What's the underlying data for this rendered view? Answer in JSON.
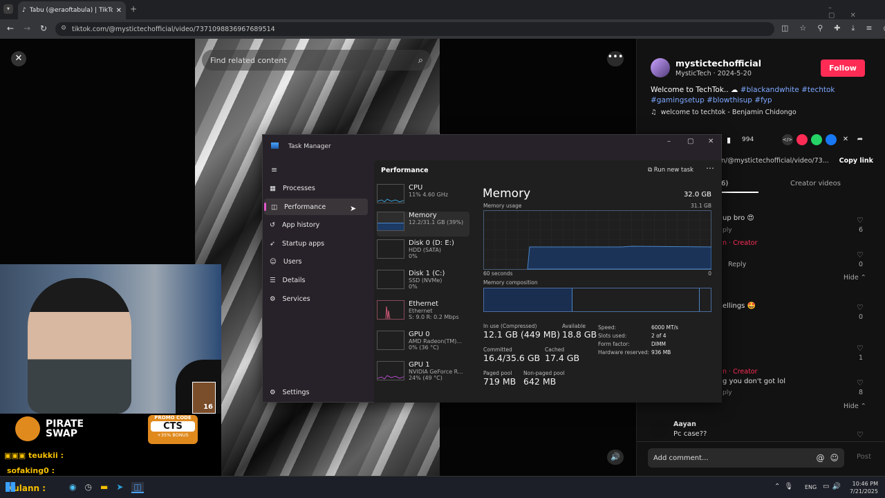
{
  "browser": {
    "tab_title": "Tabu (@eraoftabula) | TikTok",
    "url": "tiktok.com/@mystictechofficial/video/7371098836967689514"
  },
  "video": {
    "search_placeholder": "Find related content"
  },
  "post": {
    "username": "mystictechofficial",
    "meta": "MysticTech · 2024-5-20",
    "follow_label": "Follow",
    "caption_text": "Welcome to TechTok..",
    "hashtags": [
      "#blackandwhite",
      "#techtok",
      "#gamingsetup",
      "#blowthisup",
      "#fyp"
    ],
    "music": "welcome to techtok - Benjamin Chidongo",
    "bookmark_count": "994",
    "link_partial": "n/@mystictechofficial/video/73...",
    "copy_link_label": "Copy link",
    "tab_comments_partial": "6)",
    "tab_creator_videos": "Creator videos"
  },
  "comments": {
    "items": [
      {
        "text": "up bro 😍",
        "likes": "6"
      },
      {
        "text": "n · Creator",
        "likes": "0",
        "reply": "Reply"
      },
      {
        "text": "ellings 🤩",
        "likes": "0"
      },
      {
        "text": "",
        "likes": "1"
      },
      {
        "text": "n · Creator",
        "sub": "g you don't got lol",
        "likes": "8"
      },
      {
        "user": "Aayan",
        "text": "Pc case??"
      }
    ],
    "hide_label": "Hide",
    "reply_fragment": "ply",
    "add_comment_placeholder": "Add comment...",
    "post_label": "Post"
  },
  "task_manager": {
    "title": "Task Manager",
    "nav": [
      "Processes",
      "Performance",
      "App history",
      "Startup apps",
      "Users",
      "Details",
      "Services"
    ],
    "settings_label": "Settings",
    "section_title": "Performance",
    "run_new_task": "Run new task",
    "resources": [
      {
        "name": "CPU",
        "sub": "11% 4.60 GHz",
        "sub2": ""
      },
      {
        "name": "Memory",
        "sub": "12.2/31.1 GB (39%)",
        "sub2": ""
      },
      {
        "name": "Disk 0 (D: E:)",
        "sub": "HDD (SATA)",
        "sub2": "0%"
      },
      {
        "name": "Disk 1 (C:)",
        "sub": "SSD (NVMe)",
        "sub2": "0%"
      },
      {
        "name": "Ethernet",
        "sub": "Ethernet",
        "sub2": "S: 9.0 R: 0.2 Mbps"
      },
      {
        "name": "GPU 0",
        "sub": "AMD Radeon(TM)...",
        "sub2": "0% (36 °C)"
      },
      {
        "name": "GPU 1",
        "sub": "NVIDIA GeForce R...",
        "sub2": "24% (49 °C)"
      }
    ],
    "memory": {
      "heading": "Memory",
      "total": "32.0 GB",
      "usage_label": "Memory usage",
      "usage_max": "31.1 GB",
      "time_left": "60 seconds",
      "time_right": "0",
      "composition_label": "Memory composition",
      "in_use_fraction": 0.39,
      "stats": {
        "in_use_label": "In use (Compressed)",
        "in_use": "12.1 GB (449 MB)",
        "available_label": "Available",
        "available": "18.8 GB",
        "committed_label": "Committed",
        "committed": "16.4/35.6 GB",
        "cached_label": "Cached",
        "cached": "17.4 GB",
        "paged_label": "Paged pool",
        "paged": "719 MB",
        "nonpaged_label": "Non-paged pool",
        "nonpaged": "642 MB"
      },
      "details": [
        {
          "k": "Speed:",
          "v": "6000 MT/s"
        },
        {
          "k": "Slots used:",
          "v": "2 of 4"
        },
        {
          "k": "Form factor:",
          "v": "DIMM"
        },
        {
          "k": "Hardware reserved:",
          "v": "936 MB"
        }
      ]
    }
  },
  "stream": {
    "sponsor": "PIRATE SWAP",
    "promo_label": "PROMO CODE",
    "promo_code": "CTS",
    "bonus": "+35% BONUS",
    "chat": [
      {
        "user": "teukkii :"
      },
      {
        "user": "sofaking0 :"
      },
      {
        "user": "Xulann :"
      }
    ],
    "badge": "16"
  },
  "taskbar": {
    "lang": "ENG",
    "time": "10:46 PM",
    "date": "7/21/2025"
  },
  "colors": {
    "accent": "#fe2c55",
    "hashtag": "#7ea8ff",
    "memory_line": "#4a86c8"
  }
}
